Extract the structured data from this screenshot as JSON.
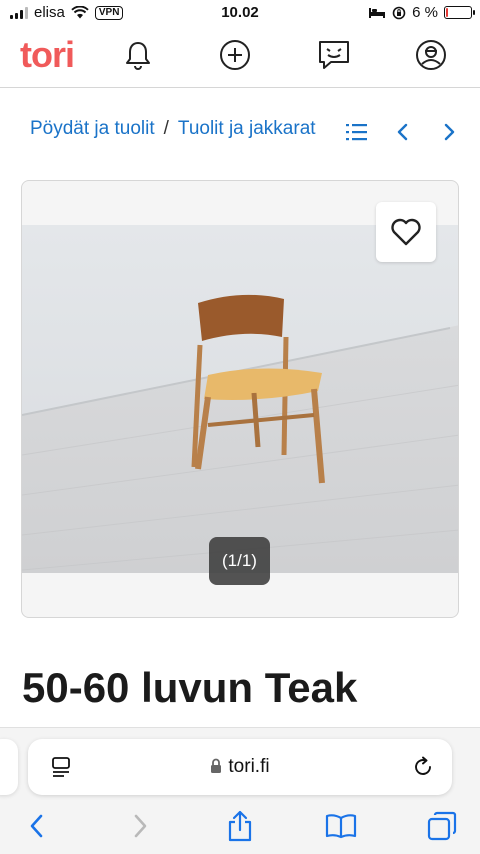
{
  "status_bar": {
    "carrier": "elisa",
    "vpn_label": "VPN",
    "time": "10.02",
    "battery_text": "6 %",
    "battery_level": 0.06
  },
  "app": {
    "logo": "tori",
    "icons": [
      "bell-icon",
      "plus-circle-icon",
      "chat-icon",
      "profile-icon"
    ]
  },
  "breadcrumb": {
    "items": [
      "Pöydät ja tuolit",
      "Tuolit ja jakkarat"
    ],
    "separator": "/"
  },
  "gallery": {
    "counter": "(1/1)"
  },
  "listing": {
    "title": "50-60 luvun Teak"
  },
  "browser": {
    "url": "tori.fi"
  },
  "colors": {
    "brand": "#f05a5a",
    "link": "#1a73c8",
    "safari_blue": "#1a73e8"
  }
}
